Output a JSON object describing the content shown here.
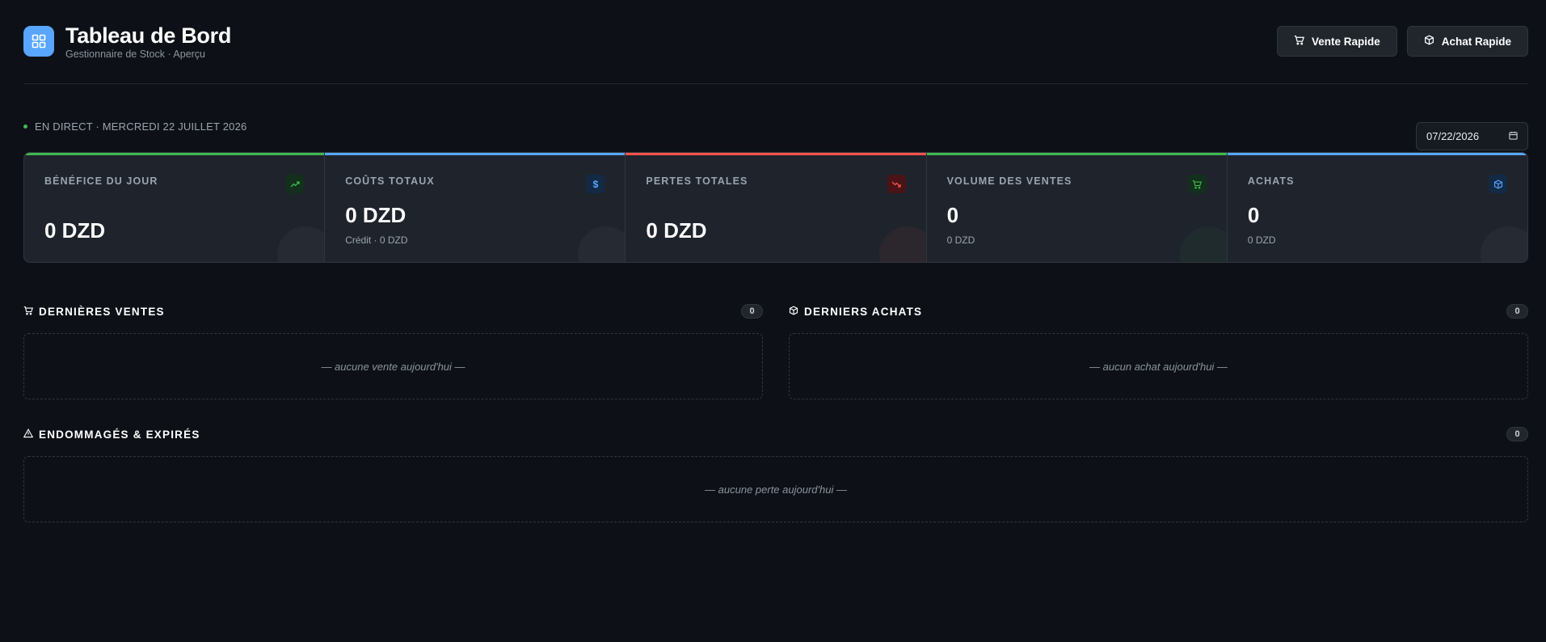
{
  "header": {
    "title": "Tableau de Bord",
    "subtitle": "Gestionnaire de Stock · Aperçu",
    "quick_sale_label": "Vente Rapide",
    "quick_purchase_label": "Achat Rapide"
  },
  "live": {
    "text": "EN DIRECT · MERCREDI 22 JUILLET 2026",
    "date_value": "07/22/2026"
  },
  "stats": [
    {
      "label": "BÉNÉFICE DU JOUR",
      "value": "0 DZD",
      "sub": "",
      "accent": "#3fb950",
      "icon": "trending-up-icon"
    },
    {
      "label": "COÛTS TOTAUX",
      "value": "0 DZD",
      "sub": "Crédit · 0 DZD",
      "accent": "#58a6ff",
      "icon": "dollar-icon"
    },
    {
      "label": "PERTES TOTALES",
      "value": "0 DZD",
      "sub": "",
      "accent": "#f85149",
      "icon": "trending-down-icon"
    },
    {
      "label": "VOLUME DES VENTES",
      "value": "0",
      "sub": "0 DZD",
      "accent": "#3fb950",
      "icon": "cart-icon"
    },
    {
      "label": "ACHATS",
      "value": "0",
      "sub": "0 DZD",
      "accent": "#58a6ff",
      "icon": "box-icon"
    }
  ],
  "sales": {
    "title": "DERNIÈRES VENTES",
    "count": "0",
    "empty": "— aucune vente aujourd'hui —"
  },
  "purchases": {
    "title": "DERNIERS ACHATS",
    "count": "0",
    "empty": "— aucun achat aujourd'hui —"
  },
  "losses": {
    "title": "ENDOMMAGÉS & EXPIRÉS",
    "count": "0",
    "empty": "— aucune perte aujourd'hui —"
  }
}
